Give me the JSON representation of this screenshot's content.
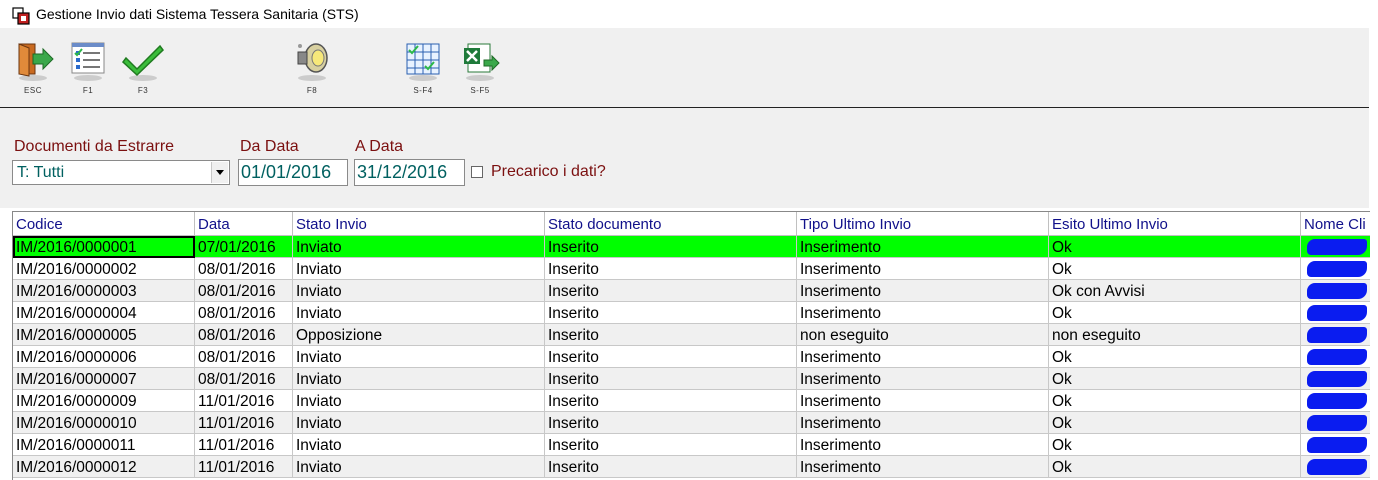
{
  "window": {
    "title": "Gestione Invio dati Sistema Tessera Sanitaria (STS)"
  },
  "toolbar": {
    "buttons": [
      {
        "key": "ESC",
        "icon": "exit-door-icon"
      },
      {
        "key": "F1",
        "icon": "checklist-icon"
      },
      {
        "key": "F3",
        "icon": "checkmark-icon"
      },
      {
        "key": "F8",
        "icon": "speaker-icon"
      },
      {
        "key": "S-F4",
        "icon": "grid-table-icon"
      },
      {
        "key": "S-F5",
        "icon": "excel-export-icon"
      }
    ]
  },
  "filters": {
    "documenti_label": "Documenti da Estrarre",
    "documenti_value": "T: Tutti",
    "da_data_label": "Da Data",
    "da_data_value": "01/01/2016",
    "a_data_label": "A Data",
    "a_data_value": "31/12/2016",
    "precarico_label": "Precarico i dati?",
    "precarico_checked": false
  },
  "table": {
    "columns": [
      "Codice",
      "Data",
      "Stato Invio",
      "Stato documento",
      "Tipo Ultimo Invio",
      "Esito Ultimo Invio",
      "Nome Cli"
    ],
    "selected_row_color": "#00ff00",
    "rows": [
      [
        "IM/2016/0000001",
        "07/01/2016",
        "Inviato",
        "Inserito",
        "Inserimento",
        "Ok"
      ],
      [
        "IM/2016/0000002",
        "08/01/2016",
        "Inviato",
        "Inserito",
        "Inserimento",
        "Ok"
      ],
      [
        "IM/2016/0000003",
        "08/01/2016",
        "Inviato",
        "Inserito",
        "Inserimento",
        "Ok con Avvisi"
      ],
      [
        "IM/2016/0000004",
        "08/01/2016",
        "Inviato",
        "Inserito",
        "Inserimento",
        "Ok"
      ],
      [
        "IM/2016/0000005",
        "08/01/2016",
        "Opposizione",
        "Inserito",
        "non eseguito",
        "non eseguito"
      ],
      [
        "IM/2016/0000006",
        "08/01/2016",
        "Inviato",
        "Inserito",
        "Inserimento",
        "Ok"
      ],
      [
        "IM/2016/0000007",
        "08/01/2016",
        "Inviato",
        "Inserito",
        "Inserimento",
        "Ok"
      ],
      [
        "IM/2016/0000009",
        "11/01/2016",
        "Inviato",
        "Inserito",
        "Inserimento",
        "Ok"
      ],
      [
        "IM/2016/0000010",
        "11/01/2016",
        "Inviato",
        "Inserito",
        "Inserimento",
        "Ok"
      ],
      [
        "IM/2016/0000011",
        "11/01/2016",
        "Inviato",
        "Inserito",
        "Inserimento",
        "Ok"
      ],
      [
        "IM/2016/0000012",
        "11/01/2016",
        "Inviato",
        "Inserito",
        "Inserimento",
        "Ok"
      ]
    ]
  }
}
